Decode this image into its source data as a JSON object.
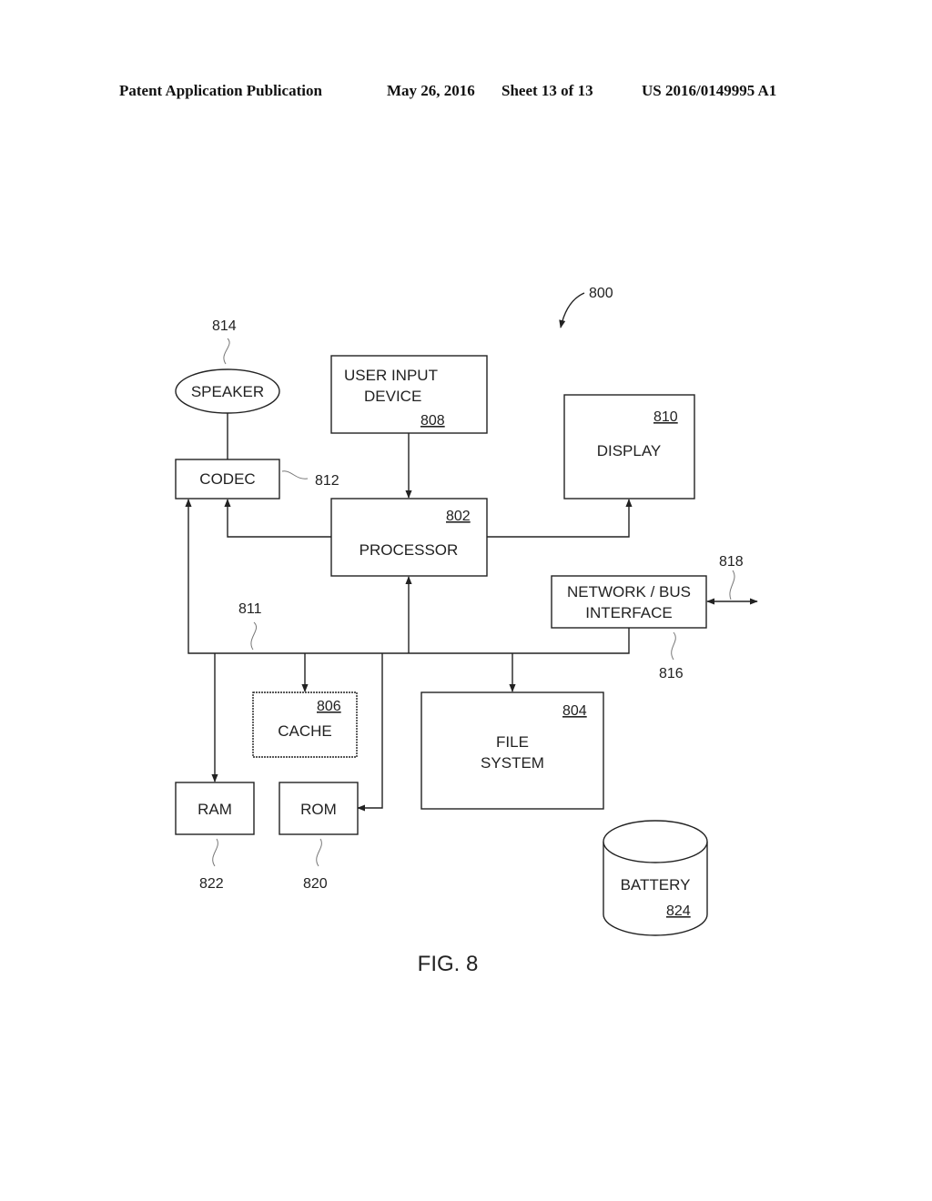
{
  "header": {
    "publication": "Patent Application Publication",
    "date": "May 26, 2016",
    "sheet": "Sheet 13 of 13",
    "patent_number": "US 2016/0149995 A1"
  },
  "figure": {
    "ref": "800",
    "caption": "FIG. 8"
  },
  "blocks": {
    "speaker": {
      "label": "SPEAKER",
      "ref": "814"
    },
    "codec": {
      "label": "CODEC",
      "ref": "812"
    },
    "user_input": {
      "label_line1": "USER INPUT",
      "label_line2": "DEVICE",
      "ref": "808"
    },
    "display": {
      "label": "DISPLAY",
      "ref": "810"
    },
    "processor": {
      "label": "PROCESSOR",
      "ref": "802"
    },
    "network": {
      "label_line1": "NETWORK / BUS",
      "label_line2": "INTERFACE",
      "ref": "816",
      "link_ref": "818"
    },
    "bus": {
      "ref": "811"
    },
    "cache": {
      "label": "CACHE",
      "ref": "806"
    },
    "file_system": {
      "label_line1": "FILE",
      "label_line2": "SYSTEM",
      "ref": "804"
    },
    "ram": {
      "label": "RAM",
      "ref": "822"
    },
    "rom": {
      "label": "ROM",
      "ref": "820"
    },
    "battery": {
      "label": "BATTERY",
      "ref": "824"
    }
  }
}
